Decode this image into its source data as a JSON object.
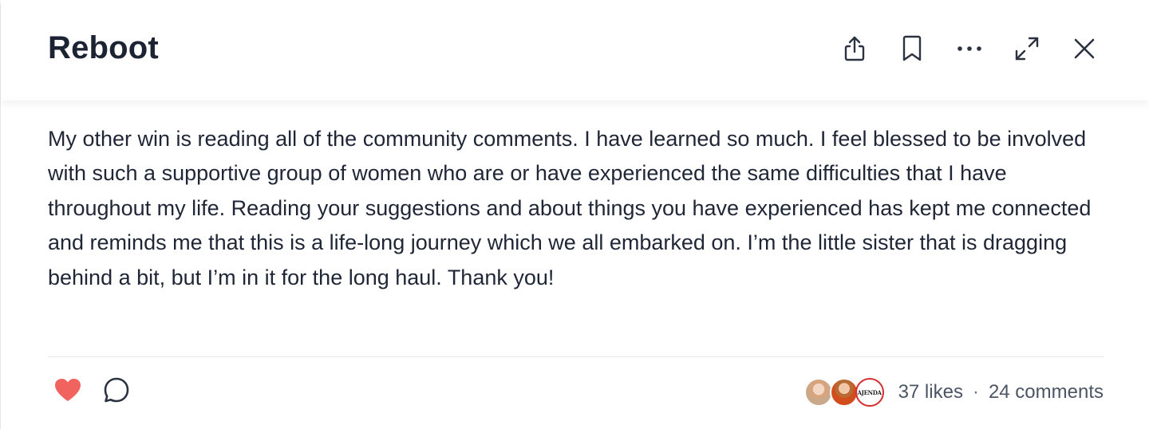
{
  "header": {
    "title": "Reboot",
    "actions": [
      {
        "name": "share-button",
        "icon": "share-icon"
      },
      {
        "name": "bookmark-button",
        "icon": "bookmark-icon"
      },
      {
        "name": "more-options-button",
        "icon": "ellipsis-icon"
      },
      {
        "name": "expand-button",
        "icon": "expand-icon"
      },
      {
        "name": "close-button",
        "icon": "close-icon"
      }
    ]
  },
  "post": {
    "body": "My other win is reading all of the community comments. I have learned so much. I feel blessed to be involved with such a supportive group of women who are or have experienced the same difficulties that I have throughout my life. Reading your suggestions and about things you have experienced has kept me connected and reminds me that this is a life-long journey which we all embarked on. I’m the little sister that is dragging behind a bit, but I’m in it for the long haul. Thank you!"
  },
  "footer": {
    "like_icon": "heart-icon",
    "comment_icon": "comment-icon",
    "like_color": "#f0635f",
    "avatars": [
      {
        "name": "liker-avatar-1"
      },
      {
        "name": "liker-avatar-2"
      },
      {
        "name": "liker-avatar-3",
        "logo_text": "AJENDA"
      }
    ],
    "likes": "37 likes",
    "separator": "·",
    "comments": "24 comments"
  }
}
